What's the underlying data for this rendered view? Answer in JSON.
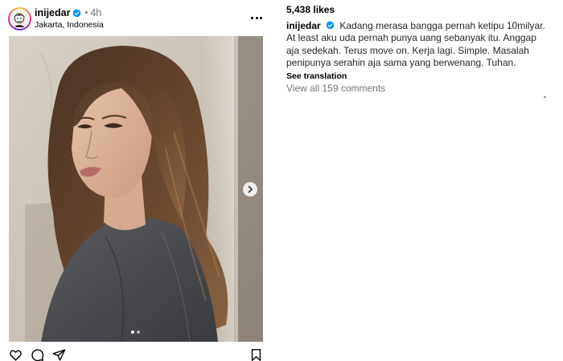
{
  "post": {
    "username": "inijedar",
    "separator": "•",
    "time": "4h",
    "location": "Jakarta, Indonesia",
    "media_slides": 2,
    "active_slide": 1
  },
  "side": {
    "likes": "5,438 likes",
    "caption_user": "inijedar",
    "caption_text": "Kadang merasa bangga pernah ketipu 10milyar. At least aku uda pernah punya uang sebanyak itu. Anggap aja sedekah. Terus move on. Kerja lagi. Simple. Masalah penipunya serahin aja sama yang berwenang. Tuhan.",
    "see_translation": "See translation",
    "view_comments": "View all 159 comments"
  },
  "icons": {
    "verified": "verified-badge-icon",
    "more": "more-options-icon",
    "like": "heart-icon",
    "comment": "comment-icon",
    "share": "share-icon",
    "save": "bookmark-icon",
    "next": "chevron-right-icon"
  },
  "colors": {
    "verified": "#0095f6",
    "secondary_text": "#737373"
  }
}
